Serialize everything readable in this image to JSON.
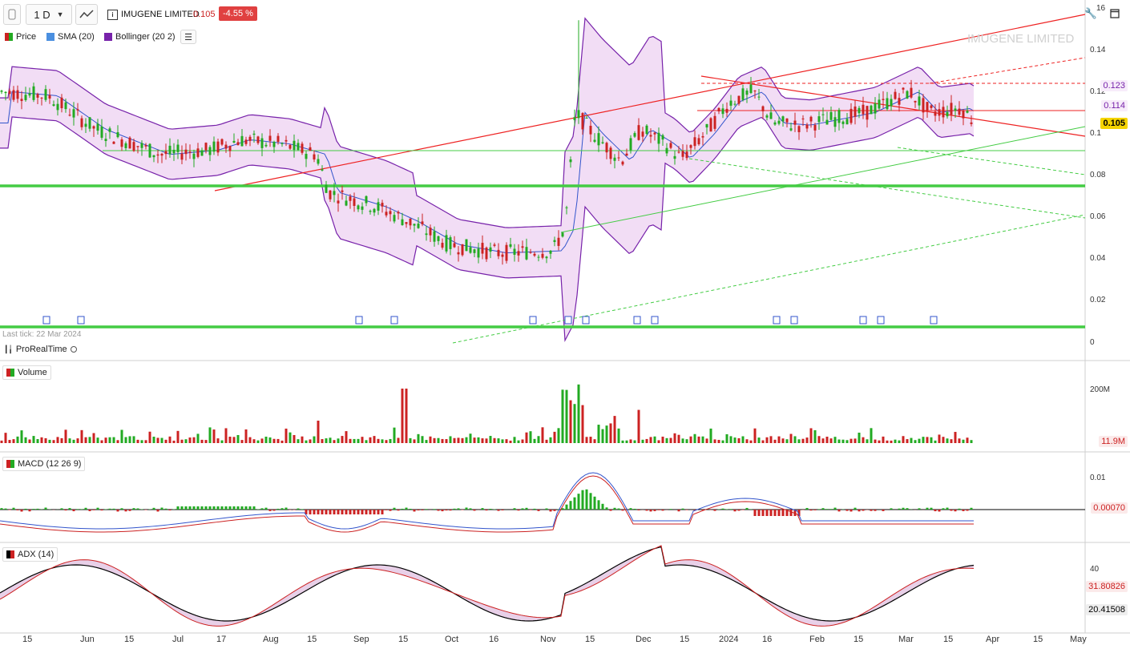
{
  "toolbar": {
    "period": "1 D",
    "instrument": "IMUGENE LIMITED",
    "price": "0.105",
    "change": "-4.55 %"
  },
  "legend": {
    "price": "Price",
    "sma": "SMA (20)",
    "bollinger": "Bollinger (20 2)"
  },
  "chart": {
    "watermark": "IMUGENE LIMITED",
    "last_tick": "Last tick: 22 Mar 2024",
    "source": "ProRealTime",
    "price_axis": [
      "16",
      "0.14",
      "0.12",
      "0.1",
      "0.08",
      "0.06",
      "0.04",
      "0.02",
      "0"
    ],
    "tags": {
      "upper": "0.123",
      "sma": "0.114",
      "last": "0.105"
    }
  },
  "volume_pane": {
    "label": "Volume",
    "axis": "200M",
    "tag": "11.9M"
  },
  "macd_pane": {
    "label": "MACD (12 26 9)",
    "axis": "0.01",
    "tag": "0.00070"
  },
  "adx_pane": {
    "label": "ADX (14)",
    "axis": "40",
    "tag1": "31.80826",
    "tag2": "20.41508"
  },
  "x_axis": [
    "15",
    "Jun",
    "15",
    "Jul",
    "17",
    "Aug",
    "15",
    "Sep",
    "15",
    "Oct",
    "16",
    "Nov",
    "15",
    "Dec",
    "15",
    "2024",
    "16",
    "Feb",
    "15",
    "Mar",
    "15",
    "Apr",
    "15",
    "May"
  ],
  "colors": {
    "up": "#22aa22",
    "down": "#cc2222",
    "sma": "#3355cc",
    "bollinger": "#7722aa",
    "band_fill": "#f2ddf5",
    "trend_red": "#ee2222",
    "trend_green": "#44cc44"
  }
}
